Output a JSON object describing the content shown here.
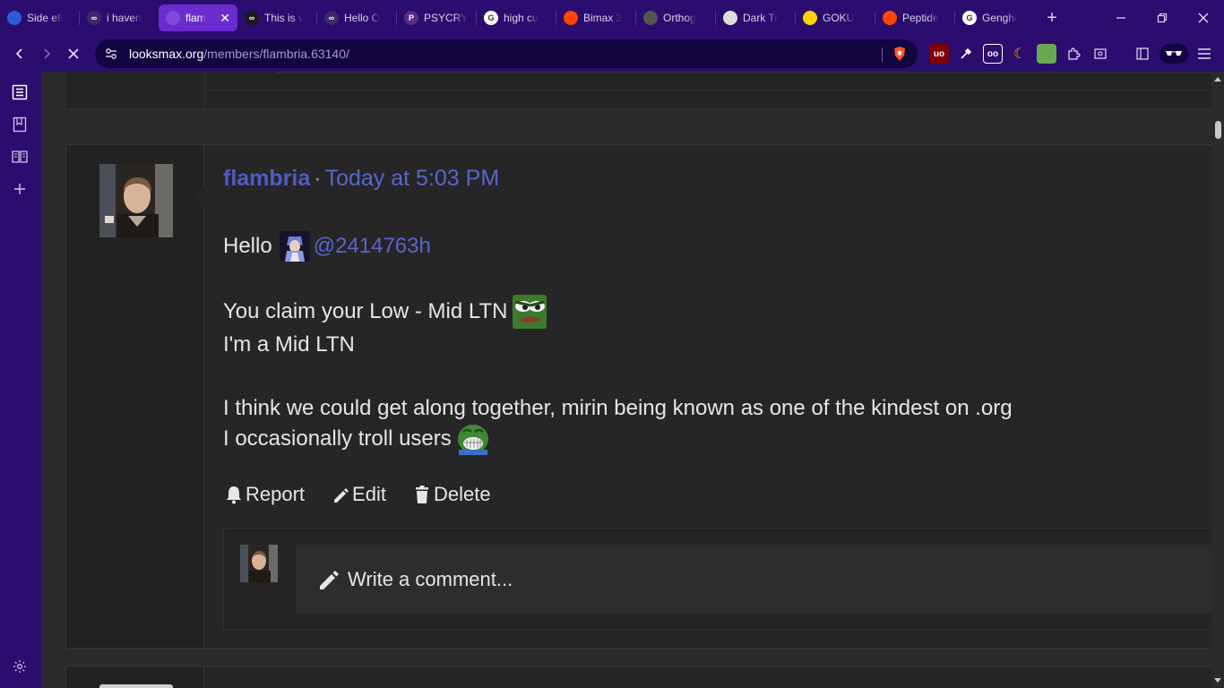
{
  "tabs": [
    {
      "title": "Side eff",
      "favicon_color": "#2b5cd6",
      "favicon_glyph": ""
    },
    {
      "title": "i haven",
      "favicon_color": "#3a2a6a",
      "favicon_glyph": "∞"
    },
    {
      "title": "flam",
      "favicon_color": "#7d4bdb",
      "favicon_glyph": "",
      "active": true
    },
    {
      "title": "This is v",
      "favicon_color": "#1a1a1a",
      "favicon_glyph": "∞"
    },
    {
      "title": "Hello O",
      "favicon_color": "#3a2a6a",
      "favicon_glyph": "∞"
    },
    {
      "title": "PSYCRY",
      "favicon_color": "#5a2a8a",
      "favicon_glyph": "P"
    },
    {
      "title": "high cu",
      "favicon_color": "#ffffff",
      "favicon_glyph": "G"
    },
    {
      "title": "Bimax 3",
      "favicon_color": "#ff4500",
      "favicon_glyph": ""
    },
    {
      "title": "Orthog",
      "favicon_color": "#555555",
      "favicon_glyph": ""
    },
    {
      "title": "Dark Tr",
      "favicon_color": "#dddddd",
      "favicon_glyph": ""
    },
    {
      "title": "GOKU",
      "favicon_color": "#ffd400",
      "favicon_glyph": ""
    },
    {
      "title": "Peptide",
      "favicon_color": "#ff4500",
      "favicon_glyph": ""
    },
    {
      "title": "Genghi",
      "favicon_color": "#ffffff",
      "favicon_glyph": "G"
    }
  ],
  "address_bar": {
    "host": "looksmax.org",
    "path": "/members/flambria.63140/"
  },
  "message": {
    "author": "flambria",
    "separator": "·",
    "time": "Today at 5:03 PM",
    "lines": {
      "hello": "Hello",
      "mention": "@2414763h",
      "claim": "You claim your Low - Mid LTN",
      "mid": "I'm a Mid LTN",
      "think": "I think we could get along together, mirin being known as one of the kindest on .org",
      "troll": "I occasionally troll users"
    },
    "actions": {
      "report": "Report",
      "edit": "Edit",
      "delete": "Delete"
    },
    "comment_placeholder": "Write a comment..."
  },
  "colors": {
    "browser_chrome": "#2a0d6e",
    "active_tab": "#6a2ccf",
    "link_blue": "#5866cc",
    "page_bg": "#2b2b2b"
  }
}
